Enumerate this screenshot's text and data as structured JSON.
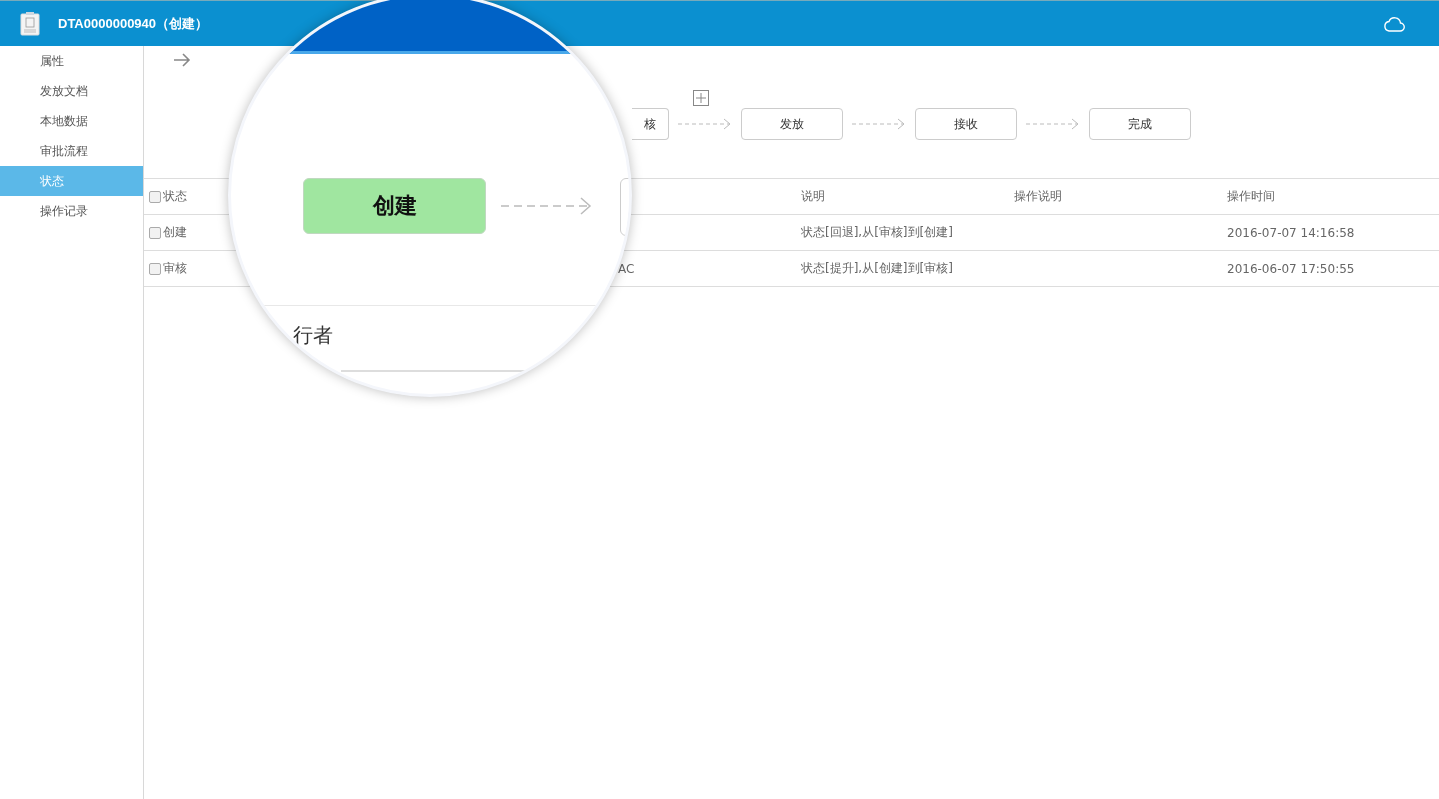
{
  "header": {
    "title": "DTA0000000940（创建）"
  },
  "sidebar": {
    "items": [
      {
        "label": "属性",
        "selected": false
      },
      {
        "label": "发放文档",
        "selected": false
      },
      {
        "label": "本地数据",
        "selected": false
      },
      {
        "label": "审批流程",
        "selected": false
      },
      {
        "label": "状态",
        "selected": true
      },
      {
        "label": "操作记录",
        "selected": false
      }
    ]
  },
  "workflow": {
    "steps": [
      {
        "label": "核"
      },
      {
        "label": "发放"
      },
      {
        "label": "接收"
      },
      {
        "label": "完成"
      }
    ]
  },
  "table": {
    "select_all_checked": false,
    "columns": {
      "status": "状态",
      "description": "说明",
      "operation_note": "操作说明",
      "time": "操作时间"
    },
    "rows": [
      {
        "status": "创建",
        "checked": false,
        "description": "状态[回退],从[审核]到[创建]",
        "time": "2016-07-07 14:16:58"
      },
      {
        "status": "审核",
        "checked": false,
        "column_2": "AC",
        "description": "状态[提升],从[创建]到[审核]",
        "time": "2016-06-07 17:50:55"
      }
    ]
  },
  "magnifier": {
    "step_label": "创建",
    "partial_text": "行者"
  }
}
